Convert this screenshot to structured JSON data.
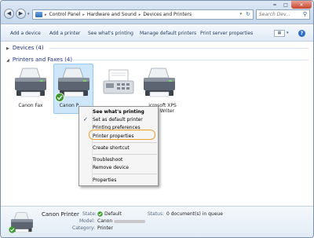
{
  "window": {
    "breadcrumb": [
      "Control Panel",
      "Hardware and Sound",
      "Devices and Printers"
    ],
    "search_placeholder": "Search Dev..."
  },
  "toolbar": {
    "add_device": "Add a device",
    "add_printer": "Add a printer",
    "whats_printing": "See what's printing",
    "manage_default": "Manage default printers",
    "print_server": "Print server properties"
  },
  "groups": {
    "devices": "Devices (4)",
    "printers": "Printers and Faxes (4)"
  },
  "printers": {
    "canon_fax": "Canon Fax",
    "canon_printer": "Canon P",
    "ms_xps_line1": "icrosoft XPS",
    "ms_xps_line2": "ent Writer"
  },
  "context_menu": {
    "see_whats_printing": "See what's printing",
    "set_default": "Set as default printer",
    "printing_prefs": "Printing preferences",
    "printer_props": "Printer properties",
    "create_shortcut": "Create shortcut",
    "troubleshoot": "Troubleshoot",
    "remove_device": "Remove device",
    "properties": "Properties"
  },
  "details": {
    "name": "Canon Printer",
    "state_label": "State:",
    "state_value": "Default",
    "status_label": "Status:",
    "status_value": "0 document(s) in queue",
    "model_label": "Model:",
    "model_value": "Canon",
    "category_label": "Category:",
    "category_value": "Printer"
  },
  "colors": {
    "selection": "#cde6f9",
    "highlight_ring": "#f0a030",
    "group_header": "#1e3287"
  }
}
